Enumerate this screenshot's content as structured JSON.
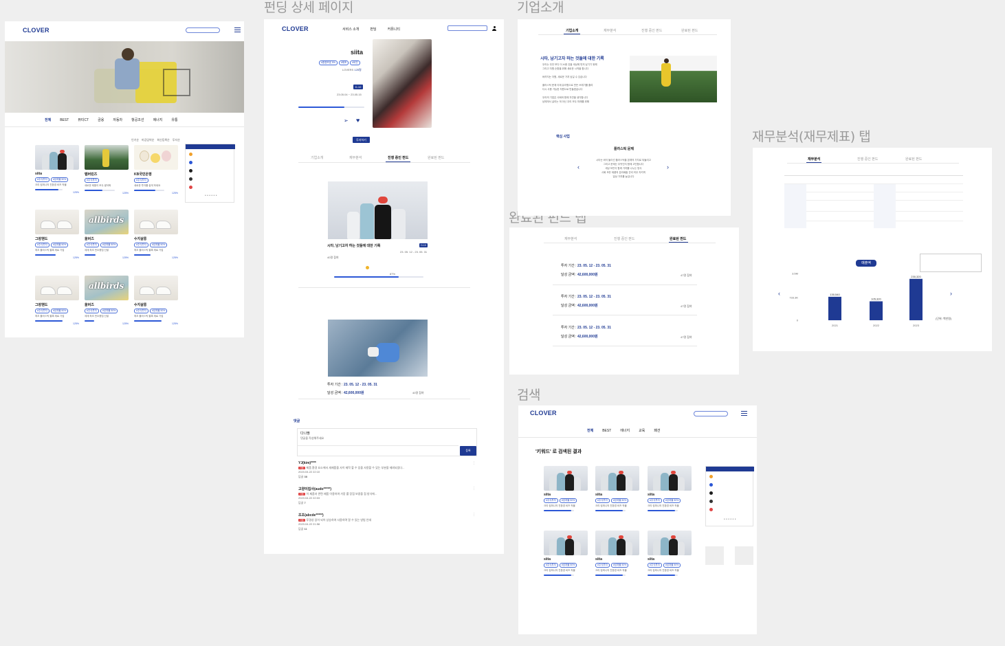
{
  "sections": {
    "funding_detail": "펀딩 상세 페이지",
    "company": "기업소개",
    "finance": "재무분석(재무제표) 탭",
    "completed": "완료된 펀드 탭",
    "search": "검색"
  },
  "brand": {
    "logo": "CLOVER",
    "accent": "#1f3a93"
  },
  "home": {
    "categories": [
      "전체",
      "BEST",
      "뷰티CT",
      "금융",
      "자동차",
      "항공조선",
      "에너지",
      "유통"
    ],
    "filters": [
      "인기순",
      "마감임박순",
      "최신등록순",
      "투자순"
    ],
    "products": [
      {
        "name": "siita",
        "pct": "125%"
      },
      {
        "name": "템버린즈",
        "pct": "125%"
      },
      {
        "name": "KB국민은행",
        "pct": "125%"
      },
      {
        "name": "그랑핸드",
        "pct": "125%"
      },
      {
        "name": "올버즈",
        "pct": "125%"
      },
      {
        "name": "수지살롱",
        "pct": "125%"
      },
      {
        "name": "그랑핸드",
        "pct": "125%"
      },
      {
        "name": "올버즈",
        "pct": "125%"
      },
      {
        "name": "수지살롱",
        "pct": "125%"
      }
    ]
  },
  "detail": {
    "nav": [
      "서비스 소개",
      "펀딩",
      "커뮤니티"
    ],
    "company": "siita",
    "dday": "D-10",
    "period": "23.05.04 ~ 23.05.15",
    "invest_btn": "투자하기",
    "tabs": [
      "기업소개",
      "재무분석",
      "진행 중인 펀드",
      "완료된 펀드"
    ],
    "fund1_title": "시타, 남기고자 하는 것들에 대한 기록",
    "fund1_badge": "D-10",
    "fund1_date": "23. 05. 12 - 23. 05. 31",
    "fund1_link": "40명 참여",
    "fund1_pct": "87%",
    "fund2_period_label": "투자 기간 :",
    "fund2_period": "23. 05. 12 - 23. 05. 31",
    "fund2_amount_label": "달성 금액 :",
    "fund2_amount": "42,600,000원",
    "fund2_count": "40명 참여",
    "comments_title": "댓글",
    "comment_user": "다나짱",
    "comment_placeholder": "댓글을 작성해주세요",
    "comment_btn": "등록",
    "comments": [
      {
        "user": "YJ(kim)****",
        "date": "2023.04.22 22:10",
        "count": "38"
      },
      {
        "user": "고양이집사(audo*****)",
        "date": "2023.04.22 22:03",
        "count": "7"
      },
      {
        "user": "조조(abcde*****)",
        "date": "2023.04.22 21:58",
        "count": "11"
      }
    ]
  },
  "company_page": {
    "tabs": [
      "기업소개",
      "재무분석",
      "진행 중인 펀드",
      "완료된 펀드"
    ],
    "heading": "시타, 남기고자 하는 것들에 대한 기록",
    "core_title": "핵심 사업",
    "core_sub": "플라스틱 문제"
  },
  "completed_tab": {
    "tabs": [
      "재무분석",
      "진행 중인 펀드",
      "완료된 펀드"
    ],
    "rows": [
      {
        "period_label": "투자 기간 :",
        "period": "23. 05. 12 - 23. 05. 31",
        "amount_label": "달성 금액 :",
        "amount": "42,600,000원",
        "count": "47명 참여"
      },
      {
        "period_label": "투자 기간 :",
        "period": "23. 05. 12 - 23. 05. 31",
        "amount_label": "달성 금액 :",
        "amount": "42,600,000원",
        "count": "47명 참여"
      },
      {
        "period_label": "투자 기간 :",
        "period": "23. 05. 12 - 23. 05. 31",
        "amount_label": "달성 금액 :",
        "amount": "42,600,000원",
        "count": "47명 참여"
      }
    ]
  },
  "finance_tab": {
    "tabs": [
      "재무분석",
      "진행 중인 펀드",
      "완료된 펀드"
    ],
    "revenue_badge": "매출액",
    "chart_data": {
      "type": "bar",
      "categories": [
        "2021",
        "2022",
        "2023"
      ],
      "values": [
        130540,
        105320,
        230320
      ],
      "value_labels": [
        "130,540",
        "105,320",
        "230,320"
      ],
      "yticks": [
        "3.5M",
        "733.3K",
        "0"
      ],
      "ylim": [
        0,
        260000
      ],
      "unit": "(단위: 백만원)"
    }
  },
  "search_page": {
    "categories": [
      "전체",
      "BEST",
      "에너지",
      "교육",
      "패션"
    ],
    "result_title": "'키워드' 로 검색된 결과",
    "products": [
      "siita",
      "siita",
      "siita",
      "siita",
      "siita",
      "siita"
    ]
  }
}
